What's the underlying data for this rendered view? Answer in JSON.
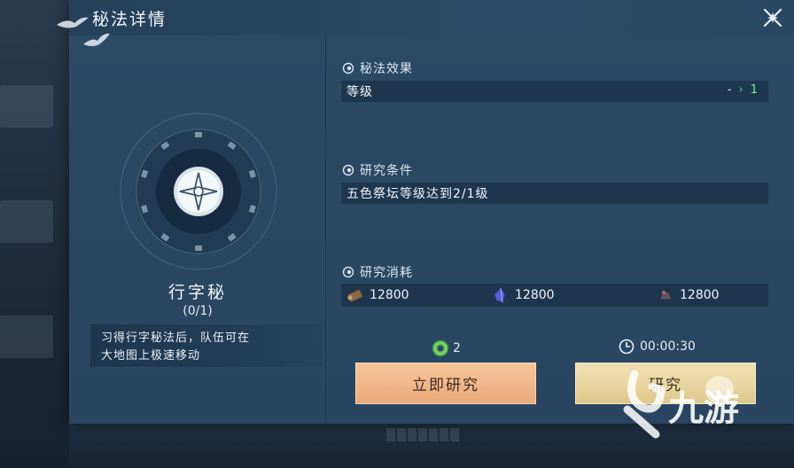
{
  "dialog": {
    "title": "秘法详情",
    "close_icon": "close-x-icon"
  },
  "skill": {
    "name": "行字秘",
    "count": "(0/1)",
    "description_line1": "习得行字秘法后，队伍可在",
    "description_line2": "大地图上极速移动",
    "emblem_icon": "compass-emblem-icon"
  },
  "effect": {
    "heading": "秘法效果",
    "label": "等级",
    "from_value": "-",
    "to_value": "1"
  },
  "condition": {
    "heading": "研究条件",
    "text": "五色祭坛等级达到2/1级"
  },
  "cost": {
    "heading": "研究消耗",
    "items": [
      {
        "icon": "wood-resource-icon",
        "amount": "12800"
      },
      {
        "icon": "crystal-resource-icon",
        "amount": "12800"
      },
      {
        "icon": "iron-resource-icon",
        "amount": "12800"
      }
    ]
  },
  "instant": {
    "jade_icon": "jade-coin-icon",
    "jade_amount": "2",
    "button_label": "立即研究"
  },
  "research": {
    "timer_icon": "clock-icon",
    "time": "00:00:30",
    "button_label": "研究"
  },
  "watermark": {
    "text": "九游"
  },
  "colors": {
    "panel": "#2c4a67",
    "instant_button": "#f0b688",
    "research_button": "#e8d49e",
    "level_arrow": "#3ee06b"
  }
}
